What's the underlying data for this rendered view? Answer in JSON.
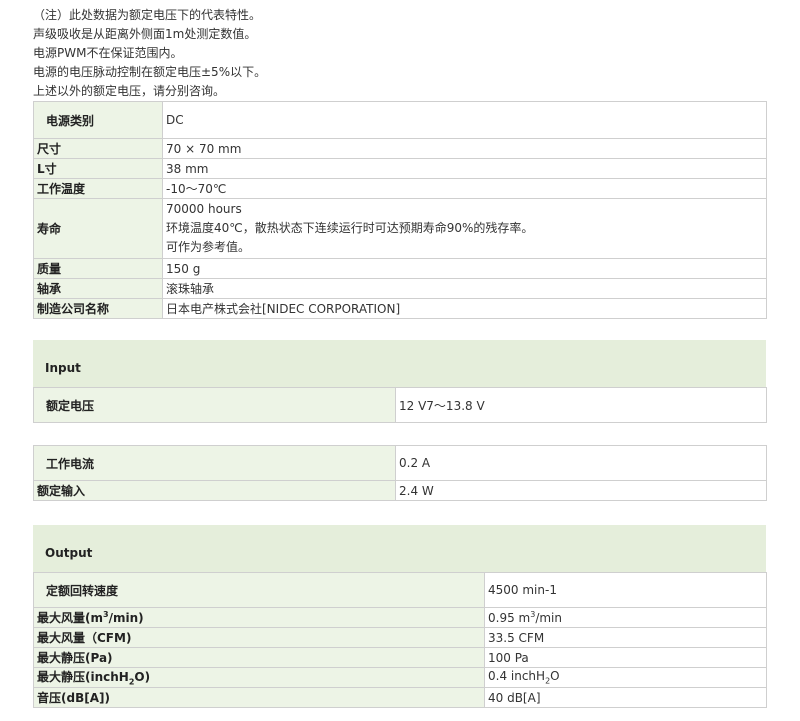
{
  "notes": [
    "（注）此处数据为额定电压下的代表特性。",
    "声级吸收是从距离外侧面1m处测定数值。",
    "电源PWM不在保证范围内。",
    "电源的电压脉动控制在额定电压±5%以下。",
    "上述以外的额定电压，请分别咨询。"
  ],
  "spec": {
    "power_type": {
      "label": "电源类别",
      "value": "DC"
    },
    "size": {
      "label": "尺寸",
      "value": "70 × 70 mm"
    },
    "length": {
      "label": "L寸",
      "value": "38 mm"
    },
    "temp": {
      "label": "工作温度",
      "value": "-10～70℃"
    },
    "life": {
      "label": "寿命",
      "lines": [
        "70000 hours",
        "环境温度40℃，散热状态下连续运行时可达预期寿命90%的残存率。",
        "可作为参考值。"
      ]
    },
    "mass": {
      "label": "质量",
      "value": "150 g"
    },
    "bearing": {
      "label": "轴承",
      "value": "滚珠轴承"
    },
    "maker": {
      "label": "制造公司名称",
      "value": "日本电产株式会社[NIDEC CORPORATION]"
    }
  },
  "input": {
    "title": "Input",
    "rated_voltage": {
      "label": "额定电压",
      "value": "12 V7～13.8 V"
    },
    "current": {
      "label": "工作电流",
      "value": "0.2 A"
    },
    "power": {
      "label": "额定输入",
      "value": "2.4 W"
    }
  },
  "output": {
    "title": "Output",
    "speed": {
      "label": "定额回转速度",
      "value": "4500 min-1"
    },
    "airflow_m3": {
      "label_pre": "最大风量(m",
      "label_sup": "3",
      "label_post": "/min)",
      "value_pre": "0.95 m",
      "value_sup": "3",
      "value_post": "/min"
    },
    "airflow_cfm": {
      "label": "最大风量（CFM)",
      "value": "33.5 CFM"
    },
    "pressure_pa": {
      "label": "最大静压(Pa)",
      "value": "100 Pa"
    },
    "pressure_inch": {
      "label_pre": "最大静压(inchH",
      "label_sub": "2",
      "label_post": "O)",
      "value_pre": "0.4 inchH",
      "value_sub": "2",
      "value_post": "O"
    },
    "noise": {
      "label": "音压(dB[A])",
      "value": "40 dB[A]"
    }
  }
}
